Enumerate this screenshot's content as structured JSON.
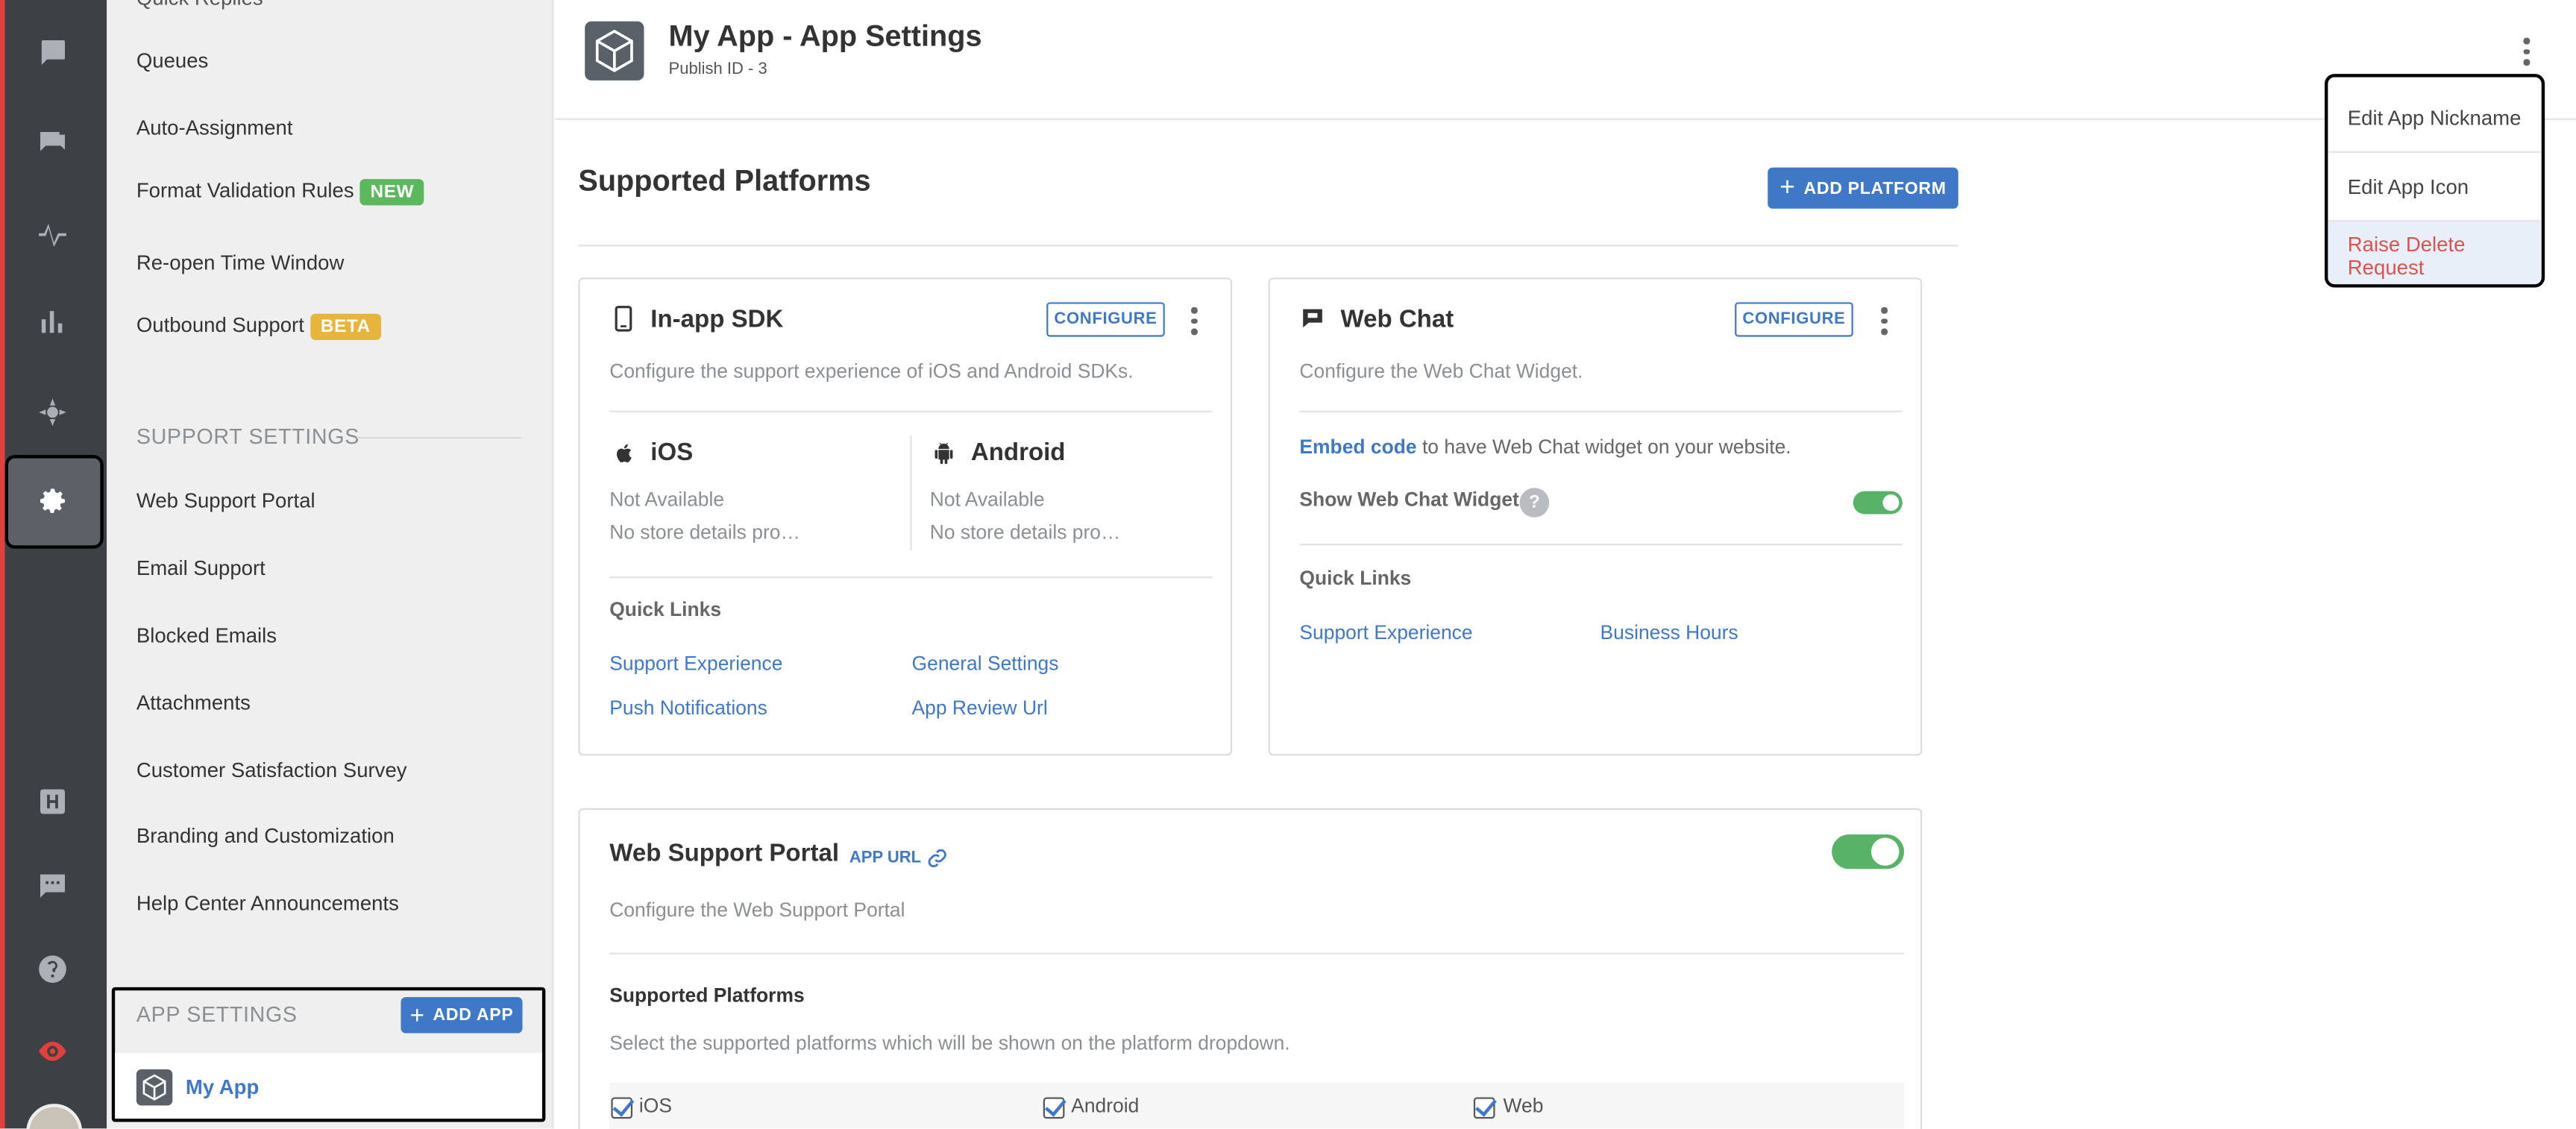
{
  "sidebar": {
    "partial_top_item": "Quick Replies",
    "items": [
      {
        "label": "Queues"
      },
      {
        "label": "Auto-Assignment"
      },
      {
        "label": "Format Validation Rules",
        "badge": "NEW"
      },
      {
        "label": "Re-open Time Window"
      },
      {
        "label": "Outbound Support",
        "badge": "BETA"
      }
    ],
    "support_settings_title": "SUPPORT SETTINGS",
    "support_items": [
      {
        "label": "Web Support Portal"
      },
      {
        "label": "Email Support"
      },
      {
        "label": "Blocked Emails"
      },
      {
        "label": "Attachments"
      },
      {
        "label": "Customer Satisfaction Survey"
      },
      {
        "label": "Branding and Customization"
      },
      {
        "label": "Help Center Announcements"
      }
    ],
    "app_settings_title": "APP SETTINGS",
    "add_app_label": "ADD APP",
    "app_name": "My App"
  },
  "header": {
    "title": "My App - App Settings",
    "publish_id": "Publish ID - 3"
  },
  "menu": {
    "items": [
      {
        "label": "Edit App Nickname"
      },
      {
        "label": "Edit App Icon"
      },
      {
        "label": "Raise Delete Request"
      }
    ]
  },
  "platforms": {
    "title": "Supported Platforms",
    "add_button": "ADD PLATFORM"
  },
  "sdk_card": {
    "title": "In-app SDK",
    "configure": "CONFIGURE",
    "description": "Configure the support experience of iOS and Android SDKs.",
    "ios": {
      "title": "iOS",
      "status": "Not Available",
      "store": "No store details pro…"
    },
    "android": {
      "title": "Android",
      "status": "Not Available",
      "store": "No store details pro…"
    },
    "quick_links_title": "Quick Links",
    "links": [
      "Support Experience",
      "General Settings",
      "Push Notifications",
      "App Review Url"
    ]
  },
  "webchat_card": {
    "title": "Web Chat",
    "configure": "CONFIGURE",
    "description": "Configure the Web Chat Widget.",
    "embed_link": "Embed code",
    "embed_text": " to have Web Chat widget on your website.",
    "show_widget_label": "Show Web Chat Widget",
    "show_widget_enabled": true,
    "quick_links_title": "Quick Links",
    "links": [
      "Support Experience",
      "Business Hours"
    ]
  },
  "portal_card": {
    "title": "Web Support Portal",
    "app_url": "APP URL",
    "enabled": true,
    "description": "Configure the Web Support Portal",
    "supported_title": "Supported Platforms",
    "supported_desc": "Select the supported platforms which will be shown on the platform dropdown.",
    "platforms": [
      "iOS",
      "Android",
      "Web"
    ]
  },
  "colors": {
    "accent": "#3f78c6",
    "badge_new": "#5cb85c",
    "badge_beta": "#e8b53c",
    "danger": "#d9534f",
    "toggle_on": "#58b368"
  }
}
